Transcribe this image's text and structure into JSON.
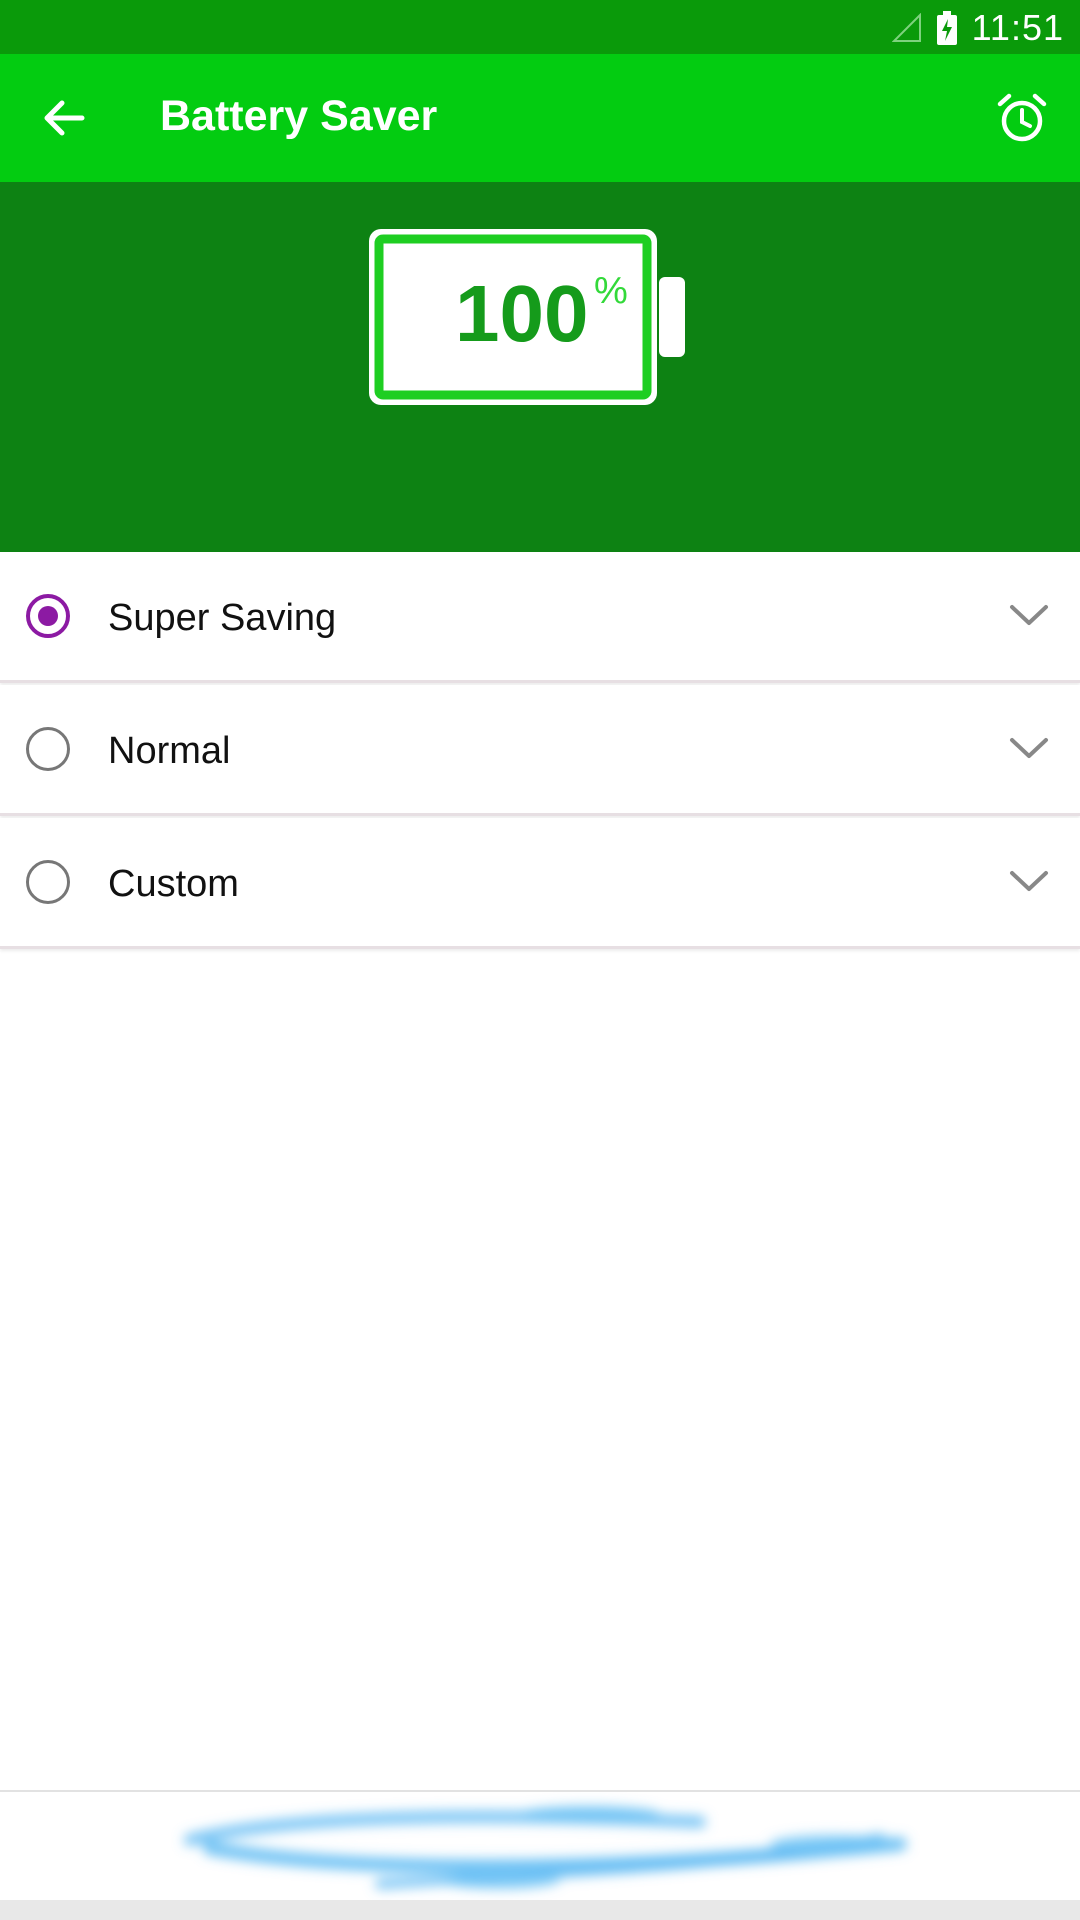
{
  "status_bar": {
    "time": "11:51",
    "icons": [
      "signal-icon",
      "battery-charging-icon"
    ]
  },
  "app_bar": {
    "title": "Battery Saver",
    "icons": [
      "back-arrow-icon",
      "alarm-clock-icon"
    ]
  },
  "battery": {
    "level_value": "100",
    "percent_sign": "%"
  },
  "options": [
    {
      "label": "Super Saving",
      "selected": true
    },
    {
      "label": "Normal",
      "selected": false
    },
    {
      "label": "Custom",
      "selected": false
    }
  ],
  "colors": {
    "status_bar": "#0a9a0a",
    "app_bar": "#03cc11",
    "hero": "#0d8213",
    "radio_selected": "#8c1aa3"
  },
  "bottom_graphic": "swirl-loading-graphic"
}
